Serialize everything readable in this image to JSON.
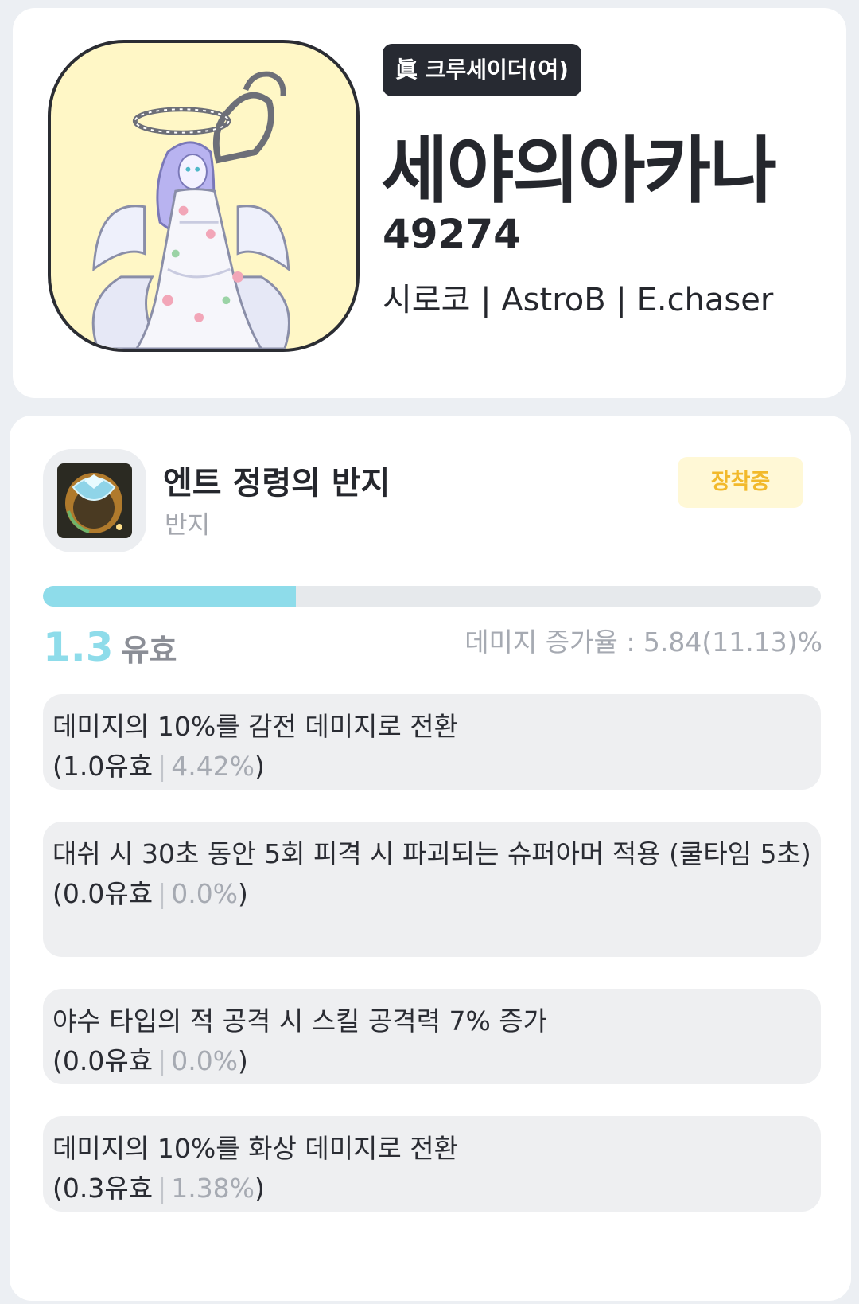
{
  "profile": {
    "class_badge": "眞 크루세이더(여)",
    "name": "세야의아카나",
    "score": "49274",
    "meta": "시로코 | AstroB | E.chaser"
  },
  "item": {
    "name": "엔트 정령의 반지",
    "type": "반지",
    "equip_status": "장착중",
    "progress_fraction": 0.325,
    "score_value": "1.3",
    "score_unit": "유효",
    "damage_rate": "데미지 증가율 : 5.84(11.13)%",
    "options": [
      {
        "text": "데미지의 10%를 감전 데미지로 전환",
        "effective": "(1.0유효",
        "separator": "|",
        "percent": "4.42%",
        "close": ")"
      },
      {
        "text": "대쉬 시 30초 동안 5회 피격 시 파괴되는 슈퍼아머 적용 (쿨타임 5초)",
        "effective": "(0.0유효",
        "separator": "|",
        "percent": "0.0%",
        "close": ")"
      },
      {
        "text": "야수 타입의 적 공격 시 스킬 공격력 7% 증가",
        "effective": "(0.0유효",
        "separator": "|",
        "percent": "0.0%",
        "close": ")"
      },
      {
        "text": "데미지의 10%를 화상 데미지로 전환",
        "effective": "(0.3유효",
        "separator": "|",
        "percent": "1.38%",
        "close": ")"
      }
    ]
  },
  "colors": {
    "accent_cyan": "#8edcea",
    "badge_dark": "#272a32",
    "equip_yellow": "#f2b92b",
    "avatar_bg": "#fff7c6"
  },
  "icons": {
    "avatar": "character-portrait",
    "item": "ring-icon"
  }
}
